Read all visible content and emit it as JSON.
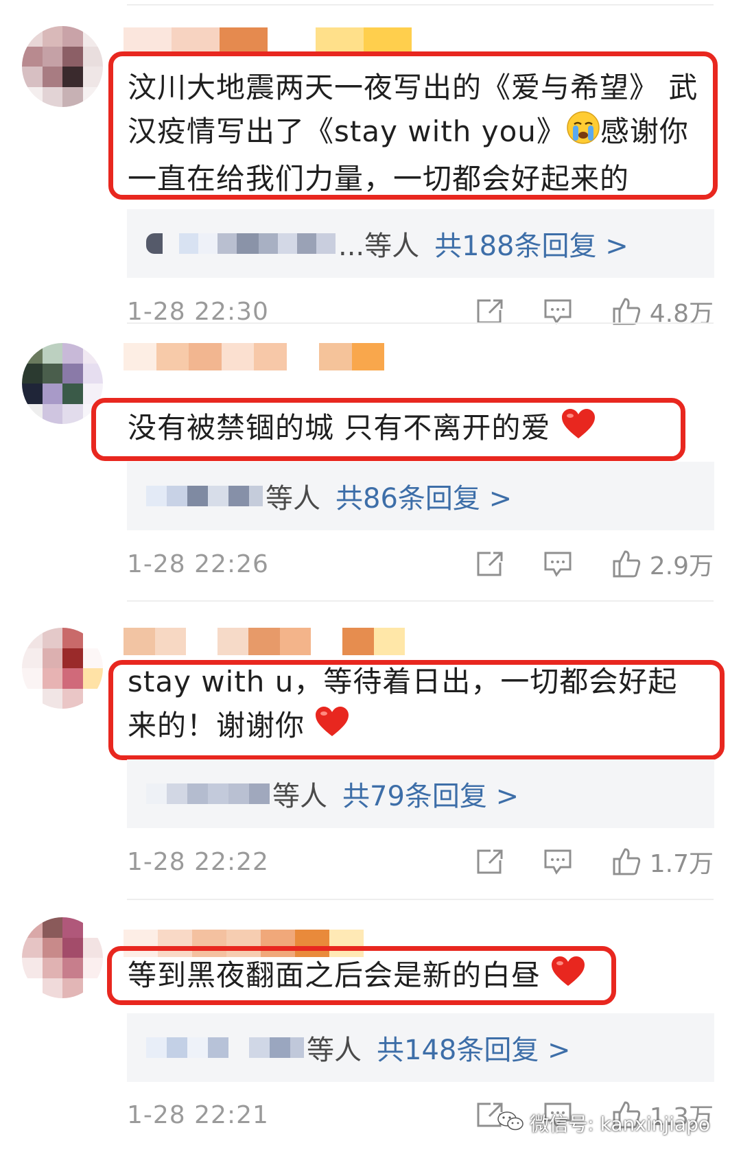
{
  "comments": [
    {
      "text": "汶川大地震两天一夜写出的《爱与希望》 武汉疫情写出了《stay with you》",
      "text_emoji": "crying-face",
      "text_after": "感谢你一直在给我们力量，一切都会好起来的",
      "reply_suffix": "...等人",
      "reply_link": "共188条回复 >",
      "time": "1-28 22:30",
      "likes": "4.8万"
    },
    {
      "text": "没有被禁锢的城 只有不离开的爱",
      "text_emoji": "red-heart",
      "text_after": "",
      "reply_suffix": "等人",
      "reply_link": "共86条回复 >",
      "time": "1-28 22:26",
      "likes": "2.9万"
    },
    {
      "text": "stay with u，等待着日出，一切都会好起来的！谢谢你",
      "text_emoji": "red-heart",
      "text_after": "",
      "reply_suffix": "等人",
      "reply_link": "共79条回复 >",
      "time": "1-28 22:22",
      "likes": "1.7万"
    },
    {
      "text": "等到黑夜翻面之后会是新的白昼",
      "text_emoji": "red-heart",
      "text_after": "",
      "reply_suffix": "等人",
      "reply_link": "共148条回复 >",
      "time": "1-28 22:21",
      "likes": "1.3万"
    }
  ],
  "watermark": "微信号: kanxinjiapo",
  "colors": {
    "highlight_border": "#e8271f",
    "reply_link": "#3d6ea8",
    "reply_bg": "#f4f5f7",
    "meta_text": "#9a9a9a"
  },
  "icons": {
    "share": "share-icon",
    "comment": "comment-icon",
    "like": "thumbs-up-icon"
  }
}
